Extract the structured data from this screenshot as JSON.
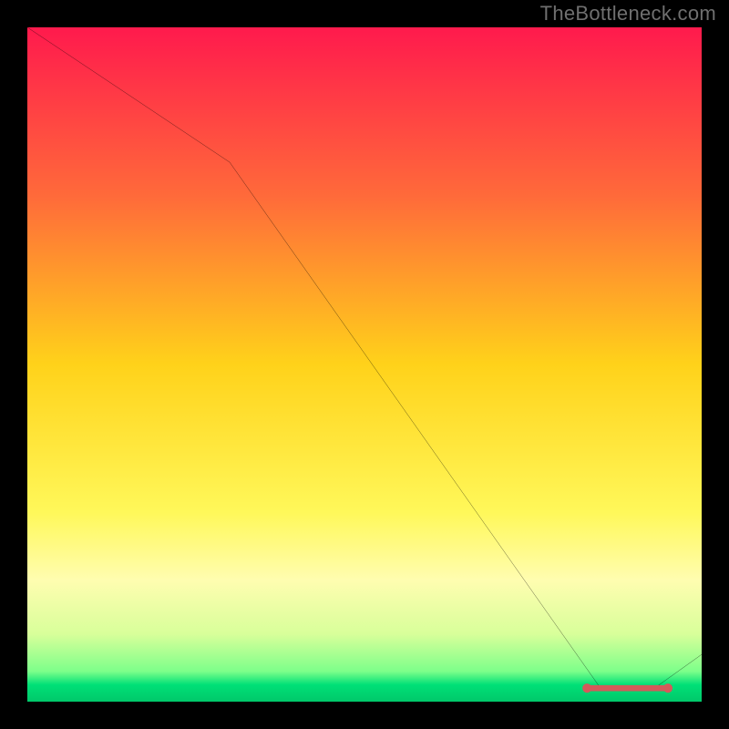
{
  "watermark": "TheBottleneck.com",
  "chart_data": {
    "type": "line",
    "title": "",
    "xlabel": "",
    "ylabel": "",
    "xlim": [
      0,
      100
    ],
    "ylim": [
      0,
      100
    ],
    "grid": false,
    "line": {
      "x": [
        0,
        30,
        85,
        93,
        100
      ],
      "y": [
        100,
        80,
        2,
        2,
        7
      ]
    },
    "flat_marker": {
      "start_x": 83,
      "end_x": 95,
      "y": 2,
      "color": "#d45a5a"
    },
    "gradient_stops": [
      {
        "offset": 0.0,
        "color": "#ff1a4d"
      },
      {
        "offset": 0.25,
        "color": "#ff6a3a"
      },
      {
        "offset": 0.5,
        "color": "#ffd21a"
      },
      {
        "offset": 0.72,
        "color": "#fff85a"
      },
      {
        "offset": 0.82,
        "color": "#fffdb0"
      },
      {
        "offset": 0.9,
        "color": "#d8ff9a"
      },
      {
        "offset": 0.955,
        "color": "#7dff8a"
      },
      {
        "offset": 0.975,
        "color": "#00e077"
      },
      {
        "offset": 1.0,
        "color": "#00c86a"
      }
    ]
  }
}
